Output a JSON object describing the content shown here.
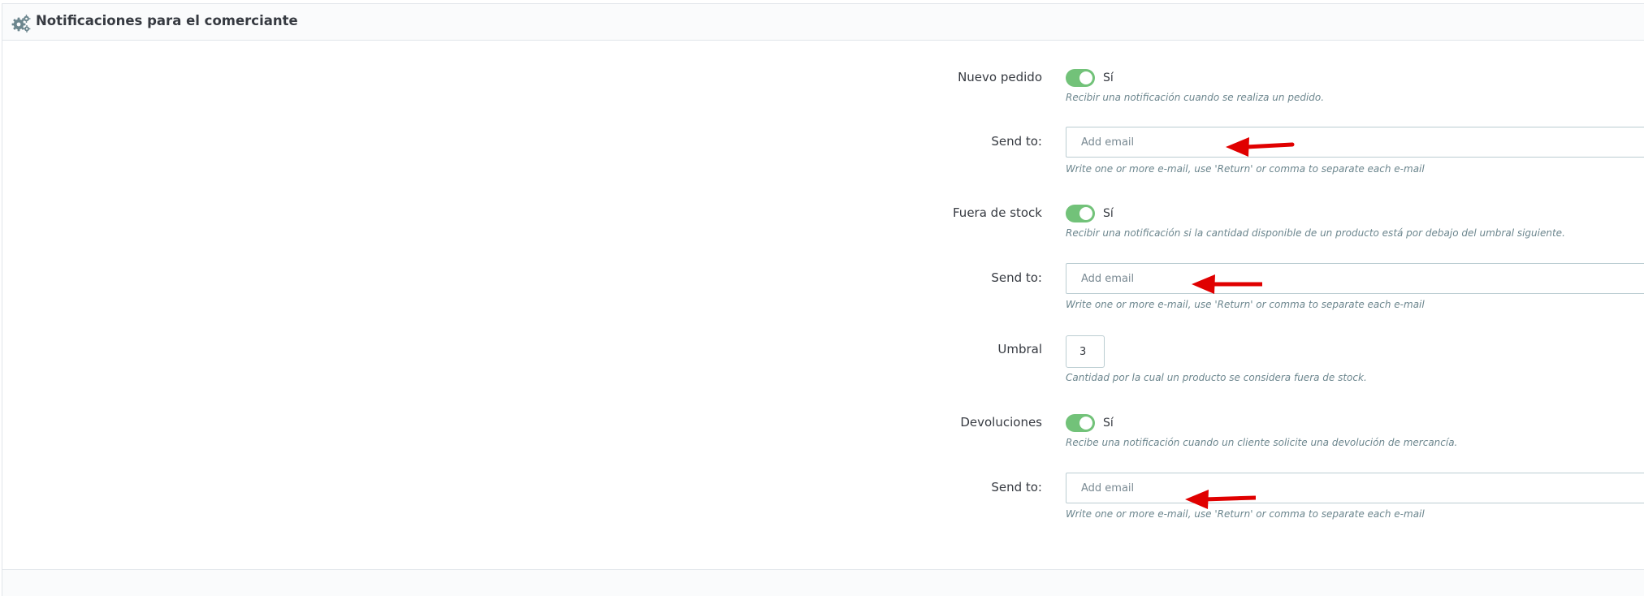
{
  "panel": {
    "title": "Notificaciones para el comerciante",
    "icon": "cogs-icon"
  },
  "fields": {
    "new_order": {
      "label": "Nuevo pedido",
      "toggle_on": true,
      "toggle_text": "Sí",
      "help": "Recibir una notificación cuando se realiza un pedido.",
      "send_to_label": "Send to:",
      "email_placeholder": "Add email",
      "email_help": "Write one or more e-mail, use 'Return' or comma to separate each e-mail"
    },
    "out_of_stock": {
      "label": "Fuera de stock",
      "toggle_on": true,
      "toggle_text": "Sí",
      "help": "Recibir una notificación si la cantidad disponible de un producto está por debajo del umbral siguiente.",
      "send_to_label": "Send to:",
      "email_placeholder": "Add email",
      "email_help": "Write one or more e-mail, use 'Return' or comma to separate each e-mail"
    },
    "threshold": {
      "label": "Umbral",
      "value": "3",
      "help": "Cantidad por la cual un producto se considera fuera de stock."
    },
    "returns": {
      "label": "Devoluciones",
      "toggle_on": true,
      "toggle_text": "Sí",
      "help": "Recibe una notificación cuando un cliente solicite una devolución de mercancía.",
      "send_to_label": "Send to:",
      "email_placeholder": "Add email",
      "email_help": "Write one or more e-mail, use 'Return' or comma to separate each e-mail"
    }
  },
  "colors": {
    "toggle_on": "#72c279",
    "annotation_arrow": "#e00000"
  }
}
